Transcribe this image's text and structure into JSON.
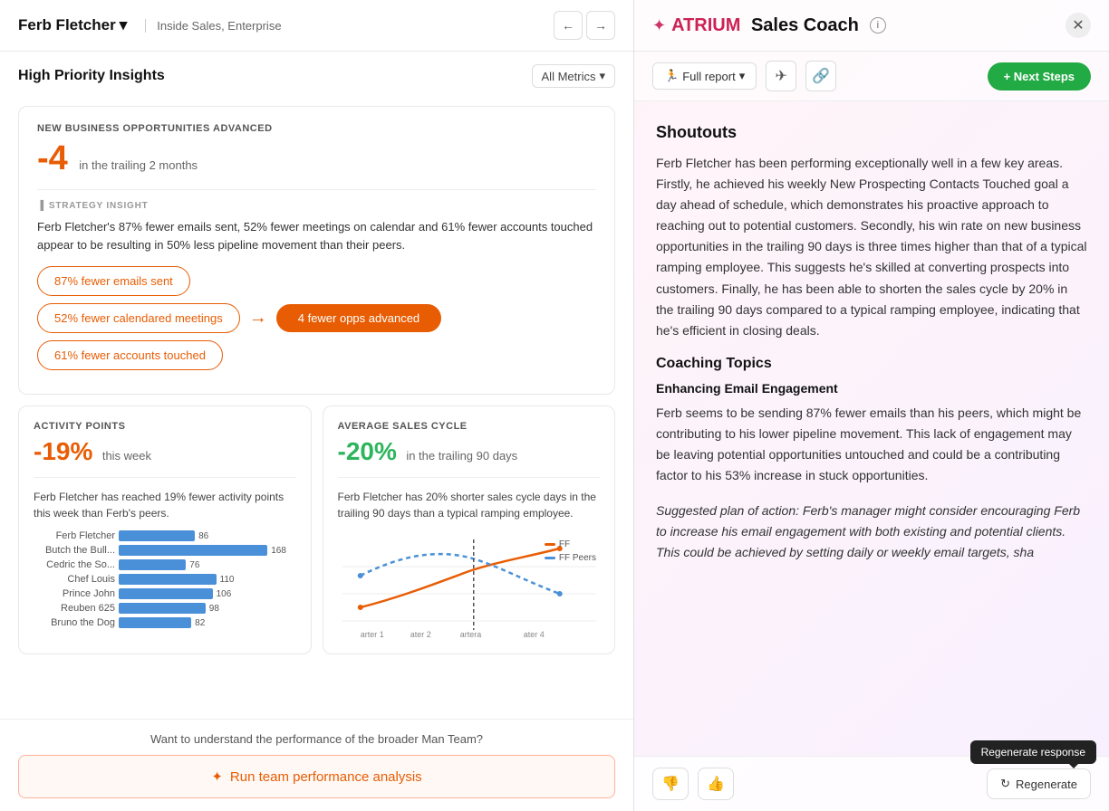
{
  "leftPanel": {
    "userName": "Ferb Fletcher",
    "userRole": "Inside Sales, Enterprise",
    "insightsTitle": "High Priority Insights",
    "metricsFilter": "All Metrics",
    "insight1": {
      "label": "NEW BUSINESS OPPORTUNITIES ADVANCED",
      "value": "-4",
      "valueSuffix": "in the trailing 2 months",
      "strategyLabel": "STRATEGY INSIGHT",
      "strategyText": "Ferb Fletcher's 87% fewer emails sent, 52% fewer meetings on calendar and 61% fewer accounts touched appear to be resulting in 50% less pipeline movement than their peers.",
      "pills": [
        "87% fewer emails sent",
        "52% fewer calendared meetings",
        "61% fewer accounts touched"
      ],
      "outcomeLabel": "4 fewer opps advanced"
    },
    "insight2": {
      "label": "ACTIVITY POINTS",
      "value": "-19%",
      "period": "this week",
      "description": "Ferb Fletcher has reached 19% fewer activity points this week than Ferb's peers.",
      "barData": [
        {
          "name": "Ferb Fletcher",
          "value": 86,
          "max": 200,
          "highlight": true
        },
        {
          "name": "Butch the Bull...",
          "value": 168,
          "max": 200
        },
        {
          "name": "Cedric the So...",
          "value": 76,
          "max": 200
        },
        {
          "name": "Chef Louis",
          "value": 110,
          "max": 200
        },
        {
          "name": "Prince John",
          "value": 106,
          "max": 200
        },
        {
          "name": "Reuben 625",
          "value": 98,
          "max": 200
        },
        {
          "name": "Bruno the Dog",
          "value": 82,
          "max": 200
        }
      ]
    },
    "insight3": {
      "label": "AVERAGE SALES CYCLE",
      "value": "-20%",
      "period": "in the trailing 90 days",
      "description": "Ferb Fletcher has 20% shorter sales cycle days in the trailing 90 days than a typical ramping employee.",
      "legend": [
        {
          "label": "FF",
          "color": "#e85d04"
        },
        {
          "label": "FF Peers",
          "color": "#4a90d9"
        }
      ]
    },
    "bottomQuestion": "Want to understand the performance of the broader Man Team?",
    "runAnalysisLabel": "Run team performance analysis"
  },
  "rightPanel": {
    "brandName": "ATRIUM",
    "titleSuffix": "Sales Coach",
    "reportDropdown": "Full report",
    "nextStepsLabel": "+ Next Steps",
    "shoutoutsTitle": "Shoutouts",
    "shoutoutsText": "Ferb Fletcher has been performing exceptionally well in a few key areas. Firstly, he achieved his weekly New Prospecting Contacts Touched goal a day ahead of schedule, which demonstrates his proactive approach to reaching out to potential customers. Secondly, his win rate on new business opportunities in the trailing 90 days is three times higher than that of a typical ramping employee. This suggests he's skilled at converting prospects into customers. Finally, he has been able to shorten the sales cycle by 20% in the trailing 90 days compared to a typical ramping employee, indicating that he's efficient in closing deals.",
    "coachingTopicsTitle": "Coaching Topics",
    "emailEngagementTitle": "Enhancing Email Engagement",
    "emailEngagementText": "Ferb seems to be sending 87% fewer emails than his peers, which might be contributing to his lower pipeline movement. This lack of engagement may be leaving potential opportunities untouched and could be a contributing factor to his 53% increase in stuck opportunities.",
    "suggestedPlanText": "Suggested plan of action: Ferb's manager might consider encouraging Ferb to increase his email engagement with both existing and potential clients. This could be achieved by setting daily or weekly email targets, sha",
    "tooltipLabel": "Regenerate response",
    "regenerateLabel": "Regenerate"
  }
}
